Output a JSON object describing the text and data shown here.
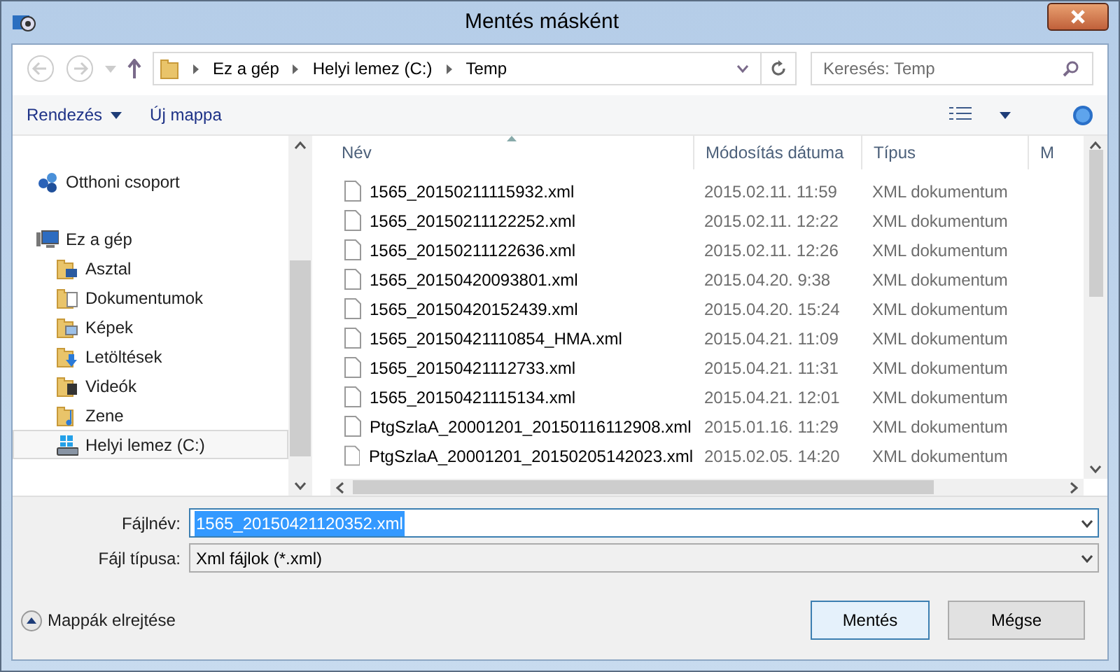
{
  "window": {
    "title": "Mentés másként"
  },
  "address": {
    "breadcrumbs": [
      "Ez a gép",
      "Helyi lemez (C:)",
      "Temp"
    ]
  },
  "search": {
    "placeholder": "Keresés: Temp"
  },
  "toolbar": [
    {
      "label": "Rendezés",
      "kind": "dropdown"
    },
    {
      "label": "Új mappa",
      "kind": "button"
    }
  ],
  "nav_pane": {
    "items": [
      {
        "label": "Otthoni csoport",
        "selected": false
      },
      {
        "label": "Ez a gép",
        "selected": false,
        "children": [
          {
            "label": "Asztal",
            "selected": false
          },
          {
            "label": "Dokumentumok",
            "selected": false
          },
          {
            "label": "Képek",
            "selected": false
          },
          {
            "label": "Letöltések",
            "selected": false
          },
          {
            "label": "Videók",
            "selected": false
          },
          {
            "label": "Zene",
            "selected": false
          },
          {
            "label": "Helyi lemez (C:)",
            "selected": true
          }
        ]
      }
    ]
  },
  "table": {
    "columns": [
      "Név",
      "Módosítás dátuma",
      "Típus",
      "M"
    ],
    "rows": [
      [
        "1565_20150211115932.xml",
        "2015.02.11. 11:59",
        "XML dokumentum"
      ],
      [
        "1565_20150211122252.xml",
        "2015.02.11. 12:22",
        "XML dokumentum"
      ],
      [
        "1565_20150211122636.xml",
        "2015.02.11. 12:26",
        "XML dokumentum"
      ],
      [
        "1565_20150420093801.xml",
        "2015.04.20. 9:38",
        "XML dokumentum"
      ],
      [
        "1565_20150420152439.xml",
        "2015.04.20. 15:24",
        "XML dokumentum"
      ],
      [
        "1565_20150421110854_HMA.xml",
        "2015.04.21. 11:09",
        "XML dokumentum"
      ],
      [
        "1565_20150421112733.xml",
        "2015.04.21. 11:31",
        "XML dokumentum"
      ],
      [
        "1565_20150421115134.xml",
        "2015.04.21. 12:01",
        "XML dokumentum"
      ],
      [
        "PtgSzlaA_20001201_20150116112908.xml",
        "2015.01.16. 11:29",
        "XML dokumentum"
      ],
      [
        "PtgSzlaA_20001201_20150205142023.xml",
        "2015.02.05. 14:20",
        "XML dokumentum"
      ]
    ]
  },
  "form": [
    {
      "label": "Fájlnév:",
      "value": "1565_20150421120352.xml",
      "selected": true
    },
    {
      "label": "Fájl típusa:",
      "value": "Xml fájlok (*.xml)",
      "selected": false
    }
  ],
  "hide_folders": "Mappák elrejtése",
  "buttons": [
    {
      "label": "Mentés",
      "default": true
    },
    {
      "label": "Mégse",
      "default": false
    }
  ]
}
